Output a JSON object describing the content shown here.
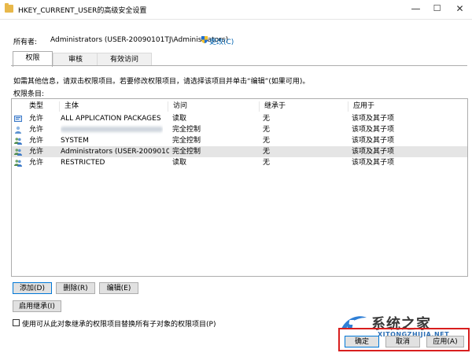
{
  "window": {
    "title": "HKEY_CURRENT_USER的高级安全设置",
    "minimize_glyph": "—",
    "maximize_glyph": "☐",
    "close_glyph": "✕"
  },
  "owner": {
    "label": "所有者:",
    "value": "Administrators (USER-20090101TJ\\Administrators)",
    "change_link": "更改(C)"
  },
  "tabs": [
    {
      "label": "权限"
    },
    {
      "label": "审核"
    },
    {
      "label": "有效访问"
    }
  ],
  "hint": "如需其他信息，请双击权限项目。若要修改权限项目，请选择该项目并单击“编辑”(如果可用)。",
  "list_label": "权限条目:",
  "columns": [
    "类型",
    "主体",
    "访问",
    "继承于",
    "应用于"
  ],
  "rows": [
    {
      "type": "允许",
      "principal": "ALL APPLICATION PACKAGES",
      "access": "读取",
      "inherited": "无",
      "applies": "该项及其子项",
      "icon": "package-icon"
    },
    {
      "type": "允许",
      "principal": "",
      "access": "完全控制",
      "inherited": "无",
      "applies": "该项及其子项",
      "icon": "user-icon"
    },
    {
      "type": "允许",
      "principal": "SYSTEM",
      "access": "完全控制",
      "inherited": "无",
      "applies": "该项及其子项",
      "icon": "group-icon"
    },
    {
      "type": "允许",
      "principal": "Administrators (USER-20090101...",
      "access": "完全控制",
      "inherited": "无",
      "applies": "该项及其子项",
      "icon": "group-icon"
    },
    {
      "type": "允许",
      "principal": "RESTRICTED",
      "access": "读取",
      "inherited": "无",
      "applies": "该项及其子项",
      "icon": "group-icon"
    }
  ],
  "buttons": {
    "add": "添加(D)",
    "remove": "删除(R)",
    "edit": "编辑(E)",
    "enable_inheritance": "启用继承(I)",
    "ok": "确定",
    "cancel": "取消",
    "apply": "应用(A)"
  },
  "replace_checkbox": "使用可从此对象继承的权限项目替换所有子对象的权限项目(P)",
  "watermark": {
    "text": "系统之家",
    "url": "XITONGZHIJIA.NET"
  },
  "colors": {
    "link": "#0063b1",
    "highlight": "#d81e1e",
    "selected_row": "#e5e5e5"
  }
}
